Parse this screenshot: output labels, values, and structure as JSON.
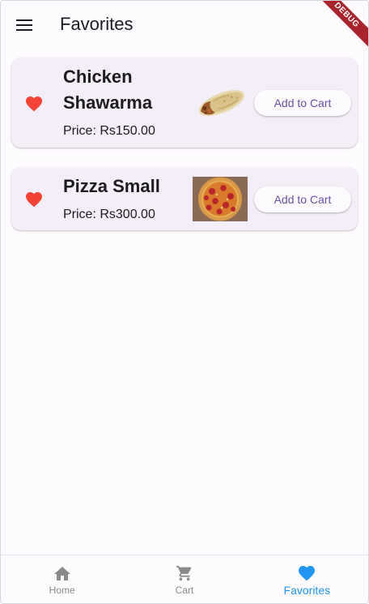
{
  "appbar": {
    "title": "Favorites",
    "menu_icon": "menu-icon",
    "debug_banner": "DEBUG"
  },
  "favorites": [
    {
      "name": "Chicken Shawarma",
      "price": "Price: Rs150.00",
      "image": "shawarma-image",
      "button_label": "Add to Cart",
      "favorited": true
    },
    {
      "name": "Pizza Small",
      "price": "Price: Rs300.00",
      "image": "pizza-image",
      "button_label": "Add to Cart",
      "favorited": true
    }
  ],
  "bottom_nav": {
    "items": [
      {
        "label": "Home",
        "icon": "home-icon",
        "active": false
      },
      {
        "label": "Cart",
        "icon": "cart-icon",
        "active": false
      },
      {
        "label": "Favorites",
        "icon": "heart-icon",
        "active": true
      }
    ]
  },
  "colors": {
    "heart": "#f44336",
    "accent": "#6750a4",
    "active_nav": "#2196f3",
    "inactive_nav": "#8a8a8a",
    "card_bg": "#f3eef7"
  }
}
